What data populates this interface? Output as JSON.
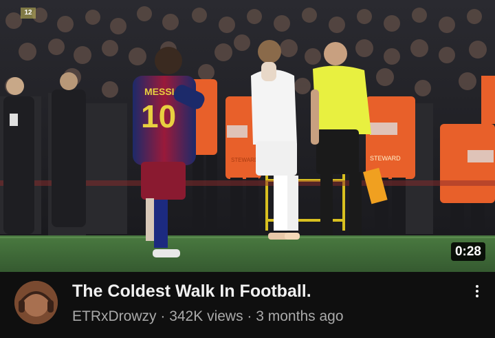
{
  "video": {
    "duration": "0:28",
    "title": "The Coldest Walk In Football.",
    "channel": "ETRxDrowzy",
    "separator": " · ",
    "views": "342K views",
    "age": "3 months ago"
  },
  "thumbnail": {
    "player_left_name": "MESSI",
    "player_left_number": "10",
    "watermark_text": "12",
    "vest_text_1": "STEWARD",
    "vest_text_2": "STEWARD",
    "icons": {
      "menu": "kebab-vertical-icon"
    }
  },
  "colors": {
    "background": "#0f0f0f",
    "title": "#f1f1f1",
    "meta": "#aaaaaa",
    "pitch": "#3f6a3a",
    "referee_yellow": "#e8f040",
    "steward_orange": "#f06a2a"
  }
}
